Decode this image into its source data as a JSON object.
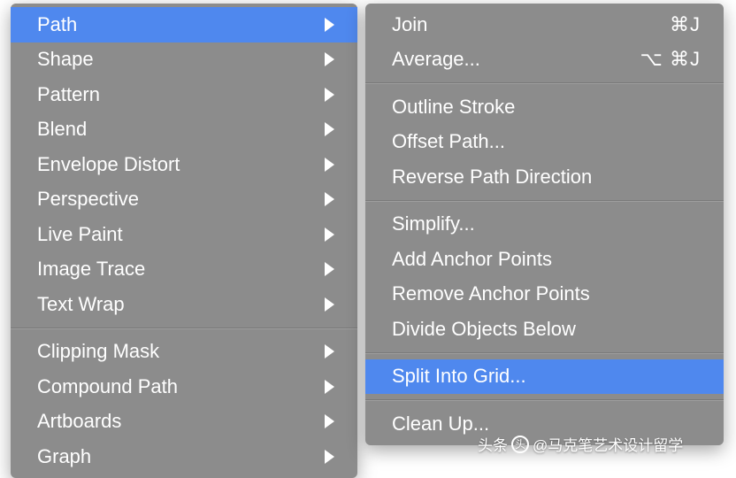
{
  "main_menu": {
    "groups": [
      [
        {
          "label": "Path",
          "hasSubmenu": true,
          "highlighted": true
        },
        {
          "label": "Shape",
          "hasSubmenu": true
        },
        {
          "label": "Pattern",
          "hasSubmenu": true
        },
        {
          "label": "Blend",
          "hasSubmenu": true
        },
        {
          "label": "Envelope Distort",
          "hasSubmenu": true
        },
        {
          "label": "Perspective",
          "hasSubmenu": true
        },
        {
          "label": "Live Paint",
          "hasSubmenu": true
        },
        {
          "label": "Image Trace",
          "hasSubmenu": true
        },
        {
          "label": "Text Wrap",
          "hasSubmenu": true
        }
      ],
      [
        {
          "label": "Clipping Mask",
          "hasSubmenu": true
        },
        {
          "label": "Compound Path",
          "hasSubmenu": true
        },
        {
          "label": "Artboards",
          "hasSubmenu": true
        },
        {
          "label": "Graph",
          "hasSubmenu": true
        }
      ]
    ]
  },
  "submenu": {
    "groups": [
      [
        {
          "label": "Join",
          "shortcut": "⌘J"
        },
        {
          "label": "Average...",
          "shortcut": "⌥ ⌘J"
        }
      ],
      [
        {
          "label": "Outline Stroke"
        },
        {
          "label": "Offset Path..."
        },
        {
          "label": "Reverse Path Direction"
        }
      ],
      [
        {
          "label": "Simplify..."
        },
        {
          "label": "Add Anchor Points"
        },
        {
          "label": "Remove Anchor Points"
        },
        {
          "label": "Divide Objects Below"
        }
      ],
      [
        {
          "label": "Split Into Grid...",
          "highlighted": true
        }
      ],
      [
        {
          "label": "Clean Up..."
        }
      ]
    ]
  },
  "watermark": {
    "prefix": "头条",
    "text": "@马克笔艺术设计留学"
  }
}
